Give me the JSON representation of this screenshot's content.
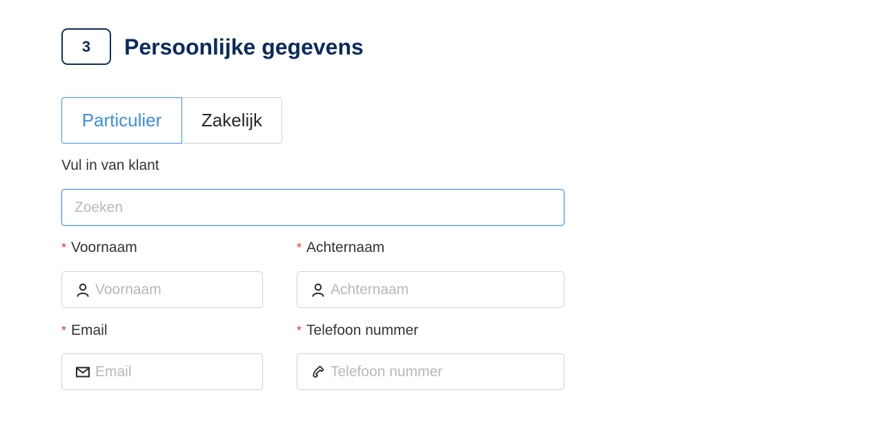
{
  "section": {
    "step_number": "3",
    "title": "Persoonlijke gegevens"
  },
  "customer_type": {
    "options": [
      "Particulier",
      "Zakelijk"
    ],
    "selected": "Particulier"
  },
  "fill_from_customer": {
    "label": "Vul in van klant",
    "search_placeholder": "Zoeken",
    "search_value": ""
  },
  "fields": {
    "first_name": {
      "label": "Voornaam",
      "placeholder": "Voornaam",
      "value": "",
      "required_mark": "*",
      "icon": "user-icon"
    },
    "last_name": {
      "label": "Achternaam",
      "placeholder": "Achternaam",
      "value": "",
      "required_mark": "*",
      "icon": "user-icon"
    },
    "email": {
      "label": "Email",
      "placeholder": "Email",
      "value": "",
      "required_mark": "*",
      "icon": "mail-icon"
    },
    "phone": {
      "label": "Telefoon nummer",
      "placeholder": "Telefoon nummer",
      "value": "",
      "required_mark": "*",
      "icon": "phone-icon"
    }
  },
  "colors": {
    "heading": "#0b2b5e",
    "accent": "#3a8ee6",
    "required": "#e5322d",
    "border": "#d0d0d0",
    "placeholder": "#b8b8b8"
  }
}
